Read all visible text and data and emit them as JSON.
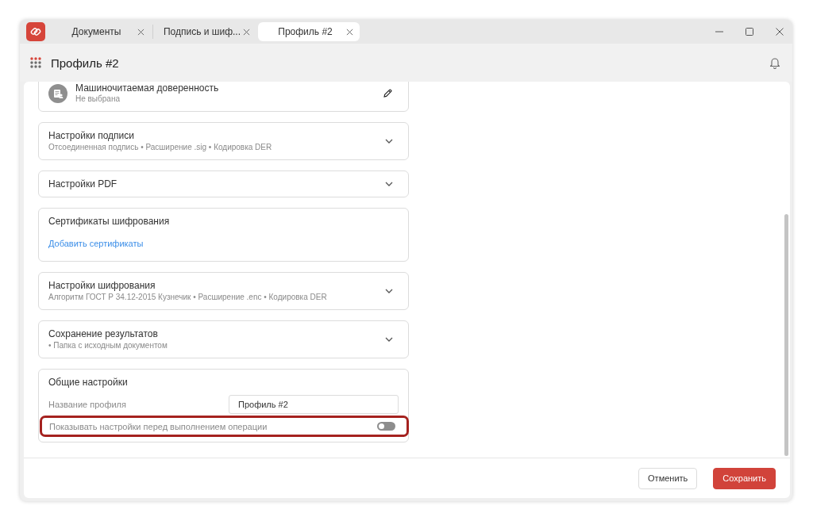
{
  "window": {
    "tabs": [
      {
        "label": "Документы",
        "selected": false
      },
      {
        "label": "Подпись и шиф...",
        "selected": false
      },
      {
        "label": "Профиль #2",
        "selected": true
      }
    ]
  },
  "header": {
    "title": "Профиль #2"
  },
  "sections": [
    {
      "kind": "picker",
      "title": "Машиночитаемая доверенность",
      "subtitle": "Не выбрана"
    },
    {
      "kind": "collapsible",
      "title": "Настройки подписи",
      "subtitle": "Отсоединенная подпись • Расширение .sig • Кодировка DER",
      "expanded": false
    },
    {
      "kind": "collapsible",
      "title": "Настройки PDF",
      "expanded": false
    },
    {
      "kind": "link",
      "title": "Сертификаты шифрования",
      "link": "Добавить сертификаты"
    },
    {
      "kind": "collapsible",
      "title": "Настройки шифрования",
      "subtitle": "Алгоритм ГОСТ Р 34.12-2015 Кузнечик • Расширение .enc • Кодировка DER",
      "expanded": false
    },
    {
      "kind": "collapsible",
      "title": "Сохранение результатов",
      "subtitle": "• Папка с исходным документом",
      "expanded": false
    },
    {
      "kind": "form",
      "title": "Общие настройки",
      "fields": [
        {
          "kind": "text",
          "label": "Название профиля",
          "value": "Профиль #2"
        },
        {
          "kind": "toggle",
          "label": "Показывать настройки перед выполнением операции",
          "on": false,
          "highlighted": true
        }
      ]
    }
  ],
  "footer": {
    "buttons": [
      {
        "kind": "secondary",
        "label": "Отменить"
      },
      {
        "kind": "primary",
        "label": "Сохранить"
      }
    ]
  }
}
